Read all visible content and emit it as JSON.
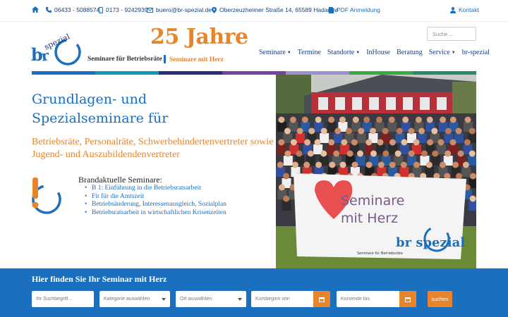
{
  "topbar": {
    "phone": "06433 - 5088574",
    "mobile": "0173 - 9242939",
    "email": "buero@br-spezial.de",
    "address": "Oberzeuzheimer Straße 14, 65589 Hadamar",
    "pdf": "PDF Anmeldung",
    "contact": "Kontakt"
  },
  "header": {
    "logo_text": "br spezial",
    "logo_sub": "Seminare für Betriebsräte",
    "anniversary": "25 Jahre",
    "tagline": "Seminare mit Herz",
    "search_placeholder": "Suche ..."
  },
  "nav": [
    {
      "label": "Seminare",
      "dropdown": true
    },
    {
      "label": "Termine",
      "dropdown": false
    },
    {
      "label": "Standorte",
      "dropdown": true
    },
    {
      "label": "InHouse",
      "dropdown": false
    },
    {
      "label": "Beratung",
      "dropdown": false
    },
    {
      "label": "Service",
      "dropdown": true
    },
    {
      "label": "br-spezial",
      "dropdown": false
    }
  ],
  "stripe_colors": [
    "#1a6fbf",
    "#0f9bb0",
    "#26307a",
    "#7a3fa0",
    "#9e8fcf",
    "#39a845",
    "#2a8a6a"
  ],
  "hero": {
    "title_line1": "Grundlagen- und",
    "title_line2": "Spezialseminare für",
    "subtitle": "Betriebsräte, Personalräte, Schwerbehindertenvertreter sowie Jugend- und Auszubildendenvertreter",
    "brand_title": "Brandaktuelle Seminare:",
    "brand_items": [
      "B 1: Einführung in die Betriebsratsarbeit",
      "Fit für die Amtszeit",
      "Betriebsänderung, Interessenausgleich, Sozialplan",
      "Betriebsratsarbeit in wirtschaftlichen Krisenzeiten"
    ]
  },
  "banner": {
    "line1": "Seminare",
    "line2": "mit Herz",
    "logo": "br spezial",
    "small": "Seminare für Betriebsräte"
  },
  "search_band": {
    "title": "Hier finden Sie Ihr Seminar mit Herz",
    "keyword_placeholder": "Ihr Suchbegriff...",
    "category": "Kategorie auswählen",
    "location": "Ort auswählen",
    "start_placeholder": "Kursbeginn von",
    "end_placeholder": "Kursende bis",
    "button": "suchen"
  },
  "colors": {
    "brand_blue": "#1a6fbf",
    "brand_orange": "#e8842a",
    "navy": "#1a3f7a"
  }
}
